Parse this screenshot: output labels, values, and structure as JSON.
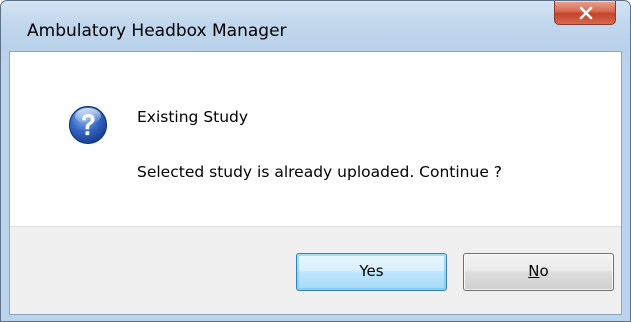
{
  "window": {
    "title": "Ambulatory Headbox Manager"
  },
  "dialog": {
    "icon": "question-icon",
    "heading": "Existing Study",
    "message": "Selected study is already uploaded. Continue ?"
  },
  "buttons": {
    "yes_label": "Yes",
    "no_mnemonic": "N",
    "no_rest": "o"
  },
  "colors": {
    "title_bar": "#c2d7ed",
    "close_button": "#c4422a",
    "default_button_border": "#3c7fb1",
    "dialog_background": "#ffffff",
    "button_strip": "#f0f0f0"
  }
}
